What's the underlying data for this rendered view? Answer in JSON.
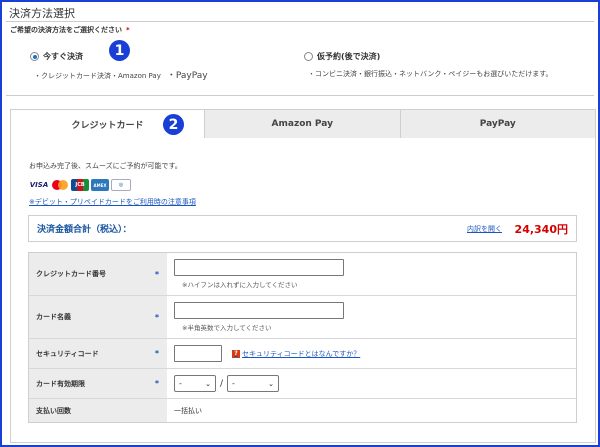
{
  "section": {
    "title": "決済方法選択",
    "subtitle": "ご希望の決済方法をご選択ください",
    "required_mark": "*"
  },
  "options": {
    "now": {
      "label": "今すぐ決済",
      "desc": "・クレジットカード決済・Amazon Pay",
      "desc_extra": "・PayPay",
      "selected": true
    },
    "later": {
      "label": "仮予約(後で決済)",
      "desc": "・コンビニ決済・銀行振込・ネットバンク・ペイジーもお選びいただけます。",
      "selected": false
    }
  },
  "badges": {
    "one": "1",
    "two": "2"
  },
  "tabs": [
    {
      "label": "クレジットカード",
      "active": true
    },
    {
      "label": "Amazon Pay",
      "active": false
    },
    {
      "label": "PayPay",
      "active": false
    }
  ],
  "panel": {
    "intro": "お申込み完了後、スムーズにご予約が可能です。",
    "card_brands": [
      "VISA",
      "Mastercard",
      "JCB",
      "AMEX",
      "Diners"
    ],
    "debit_link": "※デビット・プリペイドカードをご利用時の注意事項"
  },
  "total": {
    "label": "決済金額合計（税込）：",
    "detail_link": "内訳を開く",
    "amount": "24,340円"
  },
  "form": {
    "card_number": {
      "label": "クレジットカード番号",
      "required": "*",
      "value": "",
      "hint": "※ハイフンは入れずに入力してください"
    },
    "card_name": {
      "label": "カード名義",
      "required": "*",
      "value": "",
      "hint": "※半角英数で入力してください"
    },
    "security_code": {
      "label": "セキュリティコード",
      "required": "*",
      "value": "",
      "help_mark": "?",
      "help_link": "セキュリティコードとはなんですか？"
    },
    "expiry": {
      "label": "カード有効期限",
      "required": "*",
      "month": "-",
      "year": "-",
      "separator": "/"
    },
    "installments": {
      "label": "支払い回数",
      "value": "一括払い"
    }
  },
  "colors": {
    "accent": "#1a3fd6",
    "link": "#1a56c0",
    "amount": "#d40000"
  }
}
